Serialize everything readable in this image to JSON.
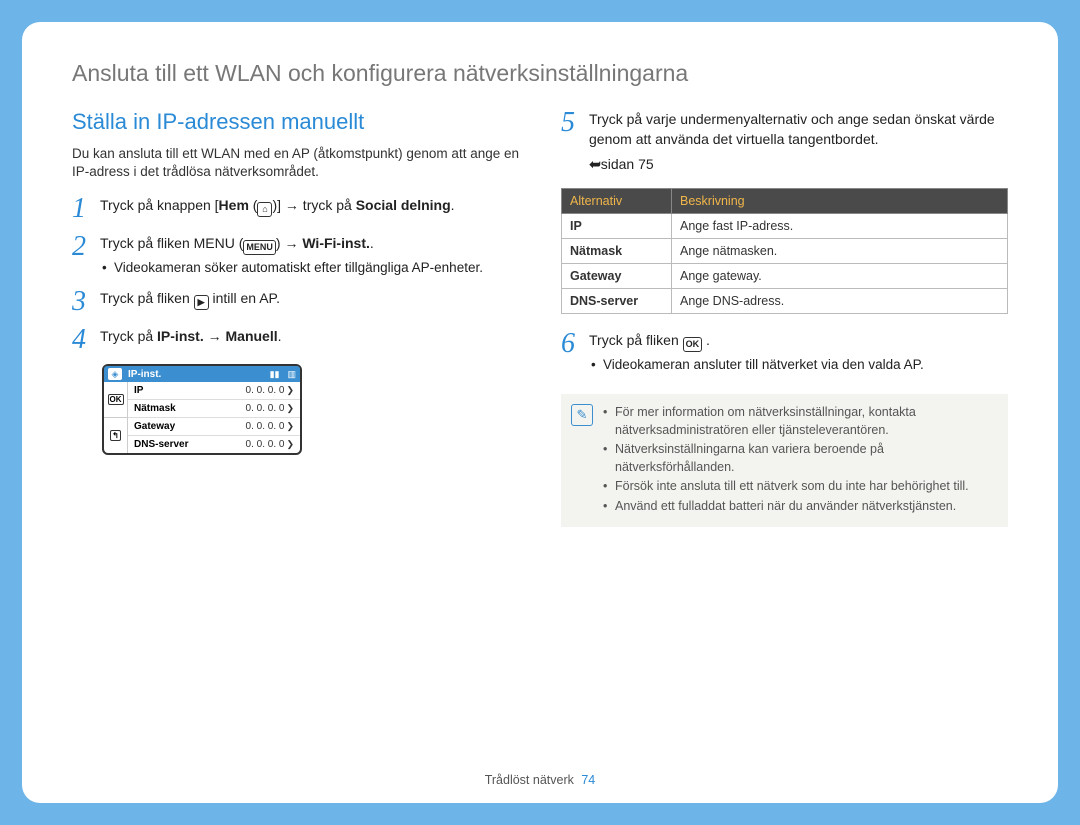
{
  "page_title": "Ansluta till ett WLAN och konfigurera nätverksinställningarna",
  "section_title": "Ställa in IP-adressen manuellt",
  "intro": "Du kan ansluta till ett WLAN med en AP (åtkomstpunkt) genom att ange en IP-adress i det trådlösa nätverksområdet.",
  "steps": {
    "s1_a": "Tryck på knappen [",
    "s1_hem": "Hem",
    "s1_b": " (",
    "s1_c": ")] ",
    "s1_d": " tryck på ",
    "s1_e": "Social delning",
    "s1_f": ".",
    "s2_a": "Tryck på fliken MENU (",
    "s2_menu": "MENU",
    "s2_b": ") ",
    "s2_c": " ",
    "s2_wifi": "Wi-Fi-inst.",
    "s2_d": ".",
    "s2_sub": "Videokameran söker automatiskt efter tillgängliga AP-enheter.",
    "s3_a": "Tryck på fliken ",
    "s3_b": " intill en AP.",
    "s4_a": "Tryck på ",
    "s4_ip": "IP-inst.",
    "s4_b": " ",
    "s4_man": "Manuell",
    "s4_c": ".",
    "s5_a": "Tryck på varje undermenyalternativ och ange sedan önskat värde genom att använda det virtuella tangentbordet.",
    "s5_ref": "sidan 75",
    "s6_a": "Tryck på fliken ",
    "s6_ok": "OK",
    "s6_b": " .",
    "s6_sub": "Videokameran ansluter till nätverket via den valda AP."
  },
  "device": {
    "title": "IP-inst.",
    "ok": "OK",
    "back": "↰",
    "rows": [
      {
        "label": "IP",
        "value": "0. 0. 0. 0"
      },
      {
        "label": "Nätmask",
        "value": "0. 0. 0. 0"
      },
      {
        "label": "Gateway",
        "value": "0. 0. 0. 0"
      },
      {
        "label": "DNS-server",
        "value": "0. 0. 0. 0"
      }
    ]
  },
  "table": {
    "head_alt": "Alternativ",
    "head_desc": "Beskrivning",
    "rows": [
      {
        "k": "IP",
        "v": "Ange fast IP-adress."
      },
      {
        "k": "Nätmask",
        "v": "Ange nätmasken."
      },
      {
        "k": "Gateway",
        "v": "Ange gateway."
      },
      {
        "k": "DNS-server",
        "v": "Ange DNS-adress."
      }
    ]
  },
  "notes": [
    "För mer information om nätverksinställningar, kontakta nätverksadministratören eller tjänsteleverantören.",
    "Nätverksinställningarna kan variera beroende på nätverksförhållanden.",
    "Försök inte ansluta till ett nätverk som du inte har behörighet till.",
    "Använd ett fulladdat batteri när du använder nätverkstjänsten."
  ],
  "footer_section": "Trådlöst nätverk",
  "footer_page": "74",
  "arrow": "→"
}
